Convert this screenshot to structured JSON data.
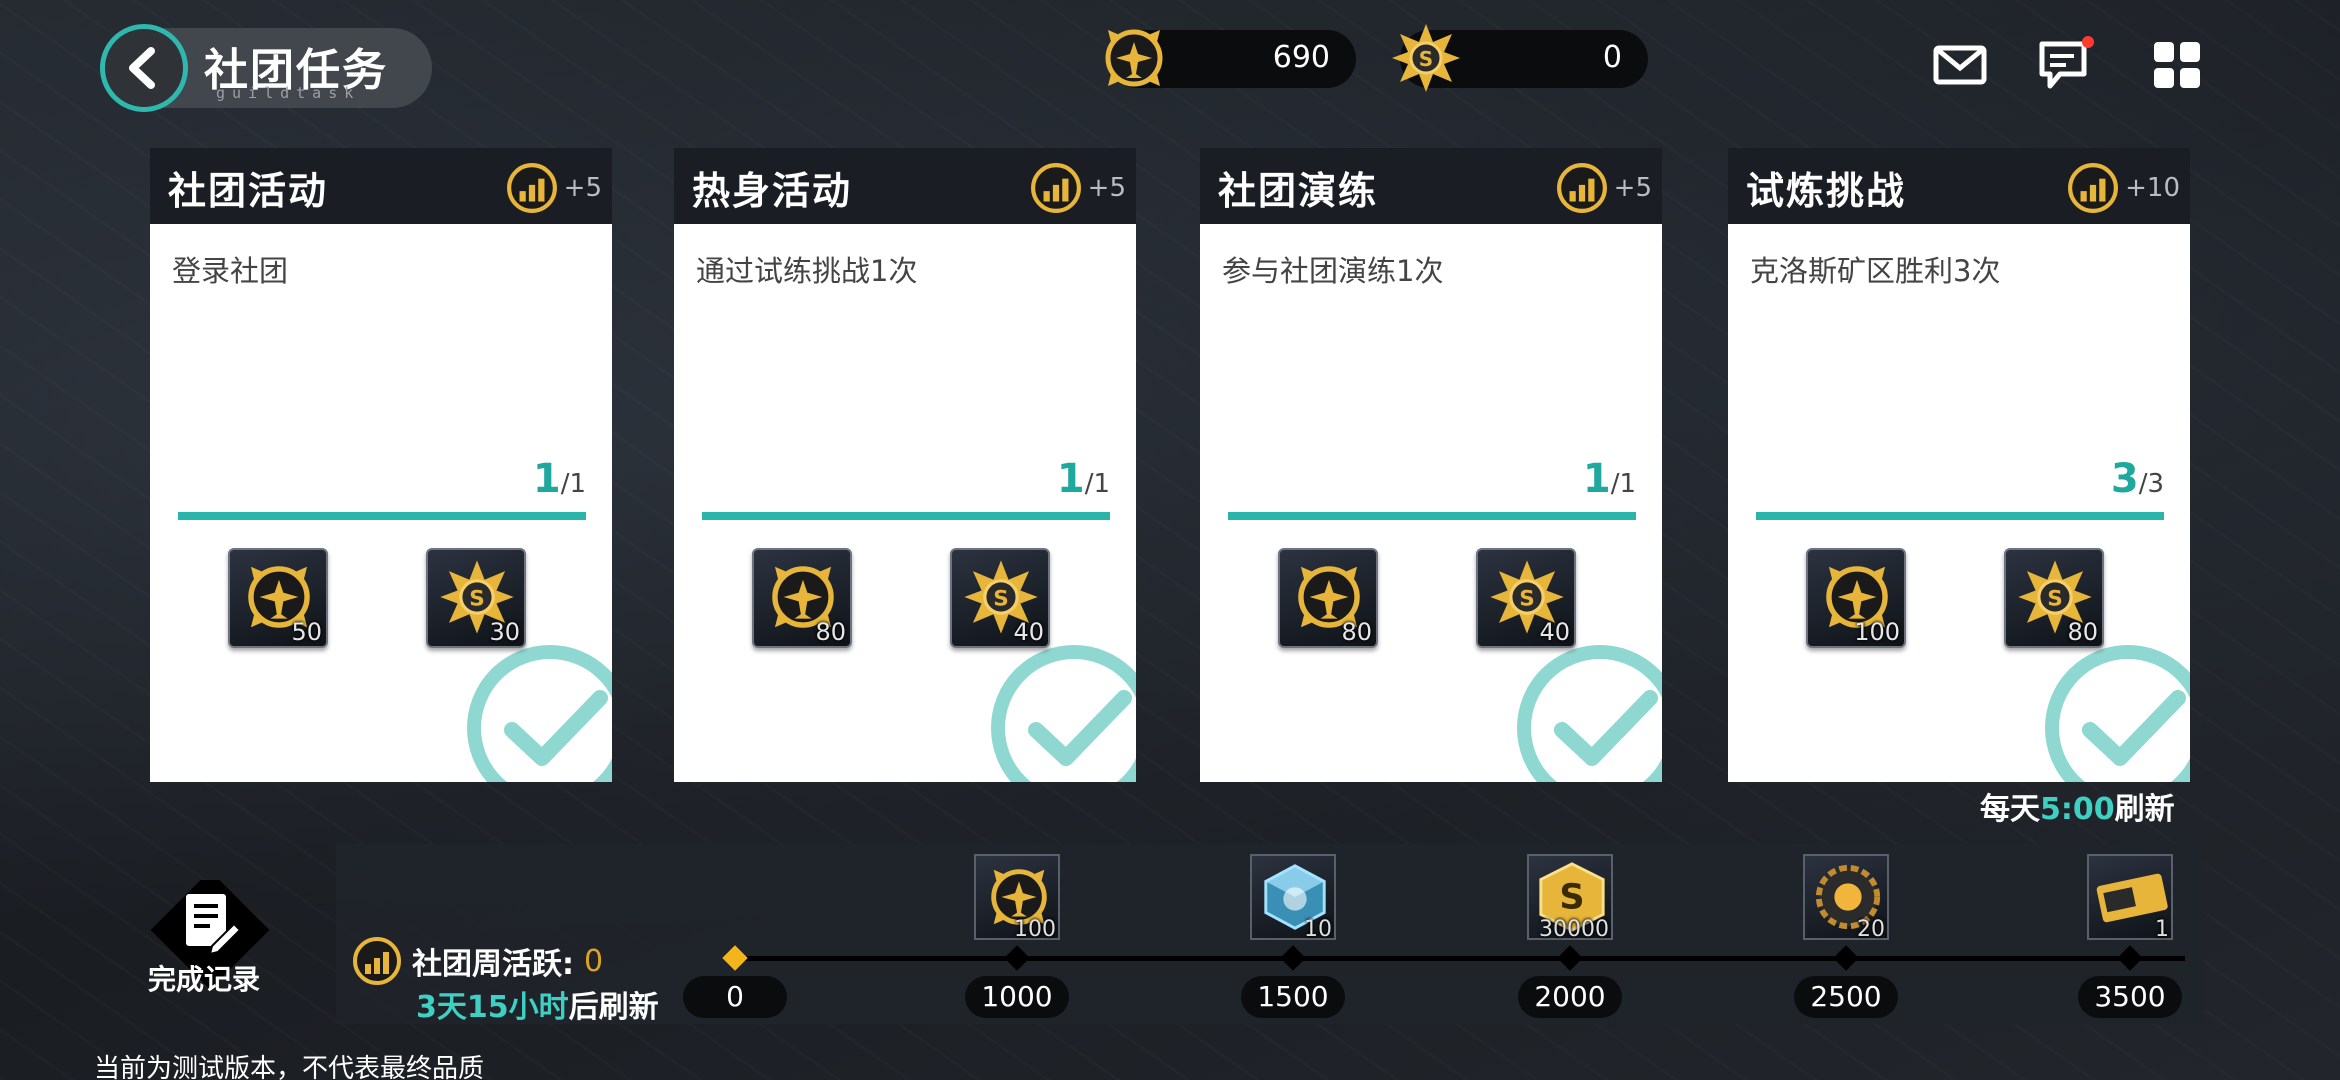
{
  "header": {
    "title": "社团任务",
    "subtitle": "guildtask",
    "currencies": [
      {
        "icon": "guild-coin-icon",
        "value": "690"
      },
      {
        "icon": "guild-medal-icon",
        "value": "0"
      }
    ],
    "icons": [
      "mail-icon",
      "chat-icon",
      "menu-grid-icon"
    ]
  },
  "tasks": [
    {
      "title": "社团活动",
      "points": "+5",
      "desc": "登录社团",
      "current": "1",
      "total": "/1",
      "progress": 1.0,
      "rewards": [
        {
          "icon": "guild-coin-icon",
          "qty": "50"
        },
        {
          "icon": "guild-medal-icon",
          "qty": "30"
        }
      ],
      "completed": true
    },
    {
      "title": "热身活动",
      "points": "+5",
      "desc": "通过试练挑战1次",
      "current": "1",
      "total": "/1",
      "progress": 1.0,
      "rewards": [
        {
          "icon": "guild-coin-icon",
          "qty": "80"
        },
        {
          "icon": "guild-medal-icon",
          "qty": "40"
        }
      ],
      "completed": true
    },
    {
      "title": "社团演练",
      "points": "+5",
      "desc": "参与社团演练1次",
      "current": "1",
      "total": "/1",
      "progress": 1.0,
      "rewards": [
        {
          "icon": "guild-coin-icon",
          "qty": "80"
        },
        {
          "icon": "guild-medal-icon",
          "qty": "40"
        }
      ],
      "completed": true
    },
    {
      "title": "试炼挑战",
      "points": "+10",
      "desc": "克洛斯矿区胜利3次",
      "current": "3",
      "total": "/3",
      "progress": 1.0,
      "rewards": [
        {
          "icon": "guild-coin-icon",
          "qty": "100"
        },
        {
          "icon": "guild-medal-icon",
          "qty": "80"
        }
      ],
      "completed": true
    }
  ],
  "daily_refresh": {
    "prefix": "每天",
    "time": "5:00",
    "suffix": "刷新"
  },
  "bottom": {
    "record_label": "完成记录",
    "weekly_label": "社团周活跃:",
    "weekly_value": "0",
    "refresh_time": "3天15小时",
    "refresh_suffix": "后刷新",
    "milestones": [
      {
        "value": "0"
      },
      {
        "value": "1000",
        "reward_icon": "guild-coin-icon",
        "qty": "100"
      },
      {
        "value": "1500",
        "reward_icon": "crystal-cube-icon",
        "qty": "10"
      },
      {
        "value": "2000",
        "reward_icon": "gold-s-coin-icon",
        "qty": "30000"
      },
      {
        "value": "2500",
        "reward_icon": "gear-orb-icon",
        "qty": "20"
      },
      {
        "value": "3500",
        "reward_icon": "ticket-icon",
        "qty": "1"
      }
    ]
  },
  "disclaimer": "当前为测试版本，不代表最终品质"
}
